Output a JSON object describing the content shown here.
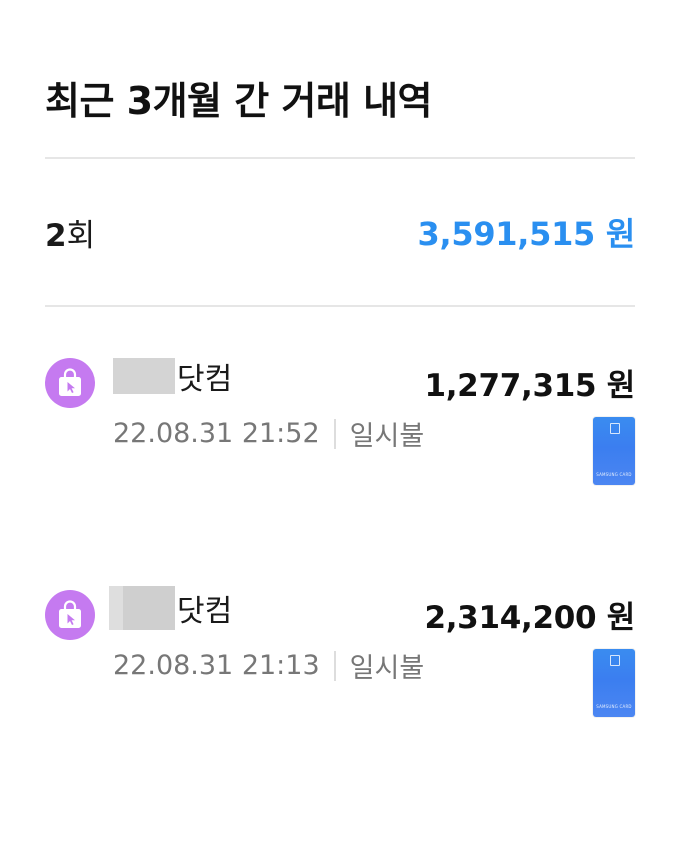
{
  "header": {
    "title": "최근 3개월 간 거래 내역"
  },
  "summary": {
    "count_number": "2",
    "count_unit": "회",
    "total": "3,591,515 원",
    "total_color": "#2a8ff0"
  },
  "transactions": [
    {
      "merchant_suffix": "닷컴",
      "amount": "1,277,315 원",
      "datetime": "22.08.31 21:52",
      "installment": "일시불",
      "icon": "shopping-bag-lock-icon",
      "icon_color": "#c57af0",
      "card_brand": "SAMSUNG CARD"
    },
    {
      "merchant_suffix": "닷컴",
      "amount": "2,314,200 원",
      "datetime": "22.08.31 21:13",
      "installment": "일시불",
      "icon": "shopping-bag-lock-icon",
      "icon_color": "#c57af0",
      "card_brand": "SAMSUNG CARD"
    }
  ]
}
